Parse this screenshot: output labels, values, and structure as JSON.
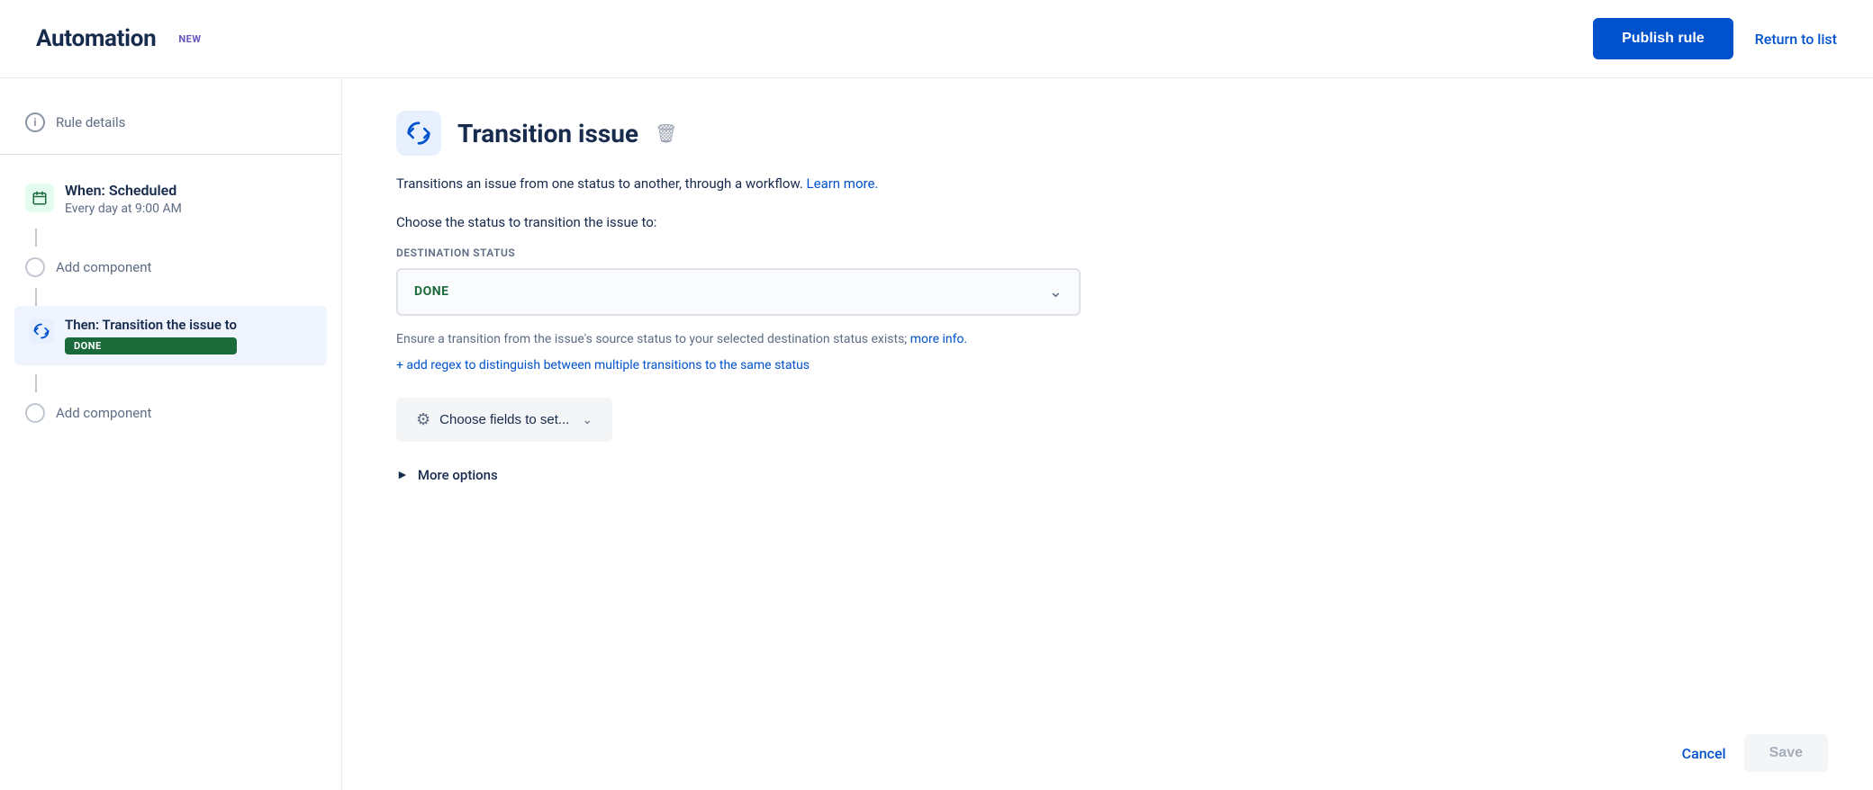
{
  "header": {
    "title": "Automation",
    "badge": "NEW",
    "publish_label": "Publish rule",
    "return_label": "Return to list"
  },
  "sidebar": {
    "rule_details_label": "Rule details",
    "trigger": {
      "label": "When: Scheduled",
      "sublabel": "Every day at 9:00 AM"
    },
    "add_component_label_1": "Add component",
    "action": {
      "label": "Then: Transition the issue to",
      "status": "DONE"
    },
    "add_component_label_2": "Add component"
  },
  "content": {
    "title": "Transition issue",
    "description": "Transitions an issue from one status to another, through a workflow.",
    "learn_more": "Learn more.",
    "choose_status": "Choose the status to transition the issue to:",
    "destination_label": "Destination status",
    "selected_status": "DONE",
    "ensure_text": "Ensure a transition from the issue's source status to your selected destination status exists;",
    "more_info": "more info.",
    "add_regex": "+ add regex to distinguish between multiple transitions to the same status",
    "choose_fields": "Choose fields to set...",
    "more_options": "More options"
  },
  "footer": {
    "cancel_label": "Cancel",
    "save_label": "Save"
  }
}
